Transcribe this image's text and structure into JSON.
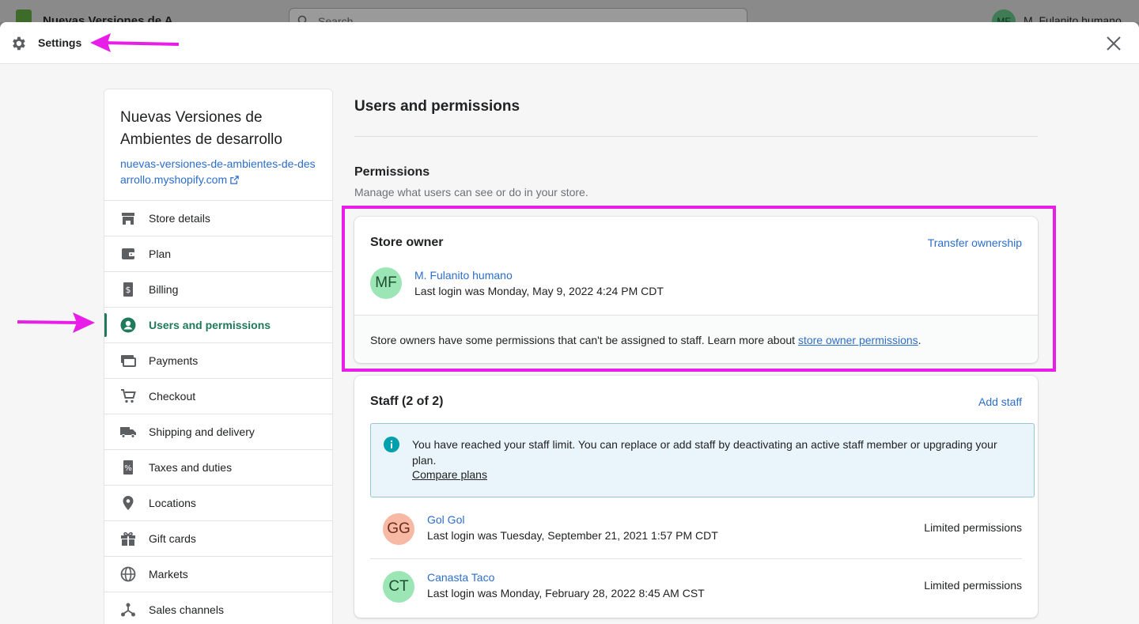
{
  "background": {
    "store_name": "Nuevas Versiones de A...",
    "search_placeholder": "Search",
    "user_initials": "MF",
    "user_name": "M. Fulanito humano"
  },
  "modal": {
    "title": "Settings"
  },
  "sidebar": {
    "store_name": "Nuevas Versiones de Ambientes de desarrollo",
    "store_url": "nuevas-versiones-de-ambientes-de-desarrollo.myshopify.com",
    "items": [
      {
        "label": "Store details",
        "icon": "store-icon"
      },
      {
        "label": "Plan",
        "icon": "plan-icon"
      },
      {
        "label": "Billing",
        "icon": "billing-icon"
      },
      {
        "label": "Users and permissions",
        "icon": "user-icon",
        "active": true
      },
      {
        "label": "Payments",
        "icon": "payments-icon"
      },
      {
        "label": "Checkout",
        "icon": "cart-icon"
      },
      {
        "label": "Shipping and delivery",
        "icon": "truck-icon"
      },
      {
        "label": "Taxes and duties",
        "icon": "tax-icon"
      },
      {
        "label": "Locations",
        "icon": "location-icon"
      },
      {
        "label": "Gift cards",
        "icon": "gift-icon"
      },
      {
        "label": "Markets",
        "icon": "globe-icon"
      },
      {
        "label": "Sales channels",
        "icon": "channels-icon"
      }
    ]
  },
  "main": {
    "title": "Users and permissions",
    "permissions_title": "Permissions",
    "permissions_subtitle": "Manage what users can see or do in your store."
  },
  "owner_card": {
    "title": "Store owner",
    "action": "Transfer ownership",
    "initials": "MF",
    "name": "M. Fulanito humano",
    "last_login": "Last login was Monday, May 9, 2022 4:24 PM CDT",
    "footer_text": "Store owners have some permissions that can't be assigned to staff. Learn more about ",
    "footer_link": "store owner permissions",
    "footer_end": "."
  },
  "staff_card": {
    "title": "Staff (2 of 2)",
    "action": "Add staff",
    "banner_text": "You have reached your staff limit. You can replace or add staff by deactivating an active staff member or upgrading your plan.",
    "banner_link": "Compare plans",
    "members": [
      {
        "initials": "GG",
        "name": "Gol Gol",
        "last_login": "Last login was Tuesday, September 21, 2021 1:57 PM CDT",
        "permissions": "Limited permissions",
        "avatar_color": "#f7b8a4"
      },
      {
        "initials": "CT",
        "name": "Canasta Taco",
        "last_login": "Last login was Monday, February 28, 2022 8:45 AM CST",
        "permissions": "Limited permissions",
        "avatar_color": "#9ce6b6"
      }
    ]
  },
  "colors": {
    "accent_green": "#1e7a5a",
    "link_blue": "#2c6ecb",
    "annotation_magenta": "#e81ee8"
  }
}
